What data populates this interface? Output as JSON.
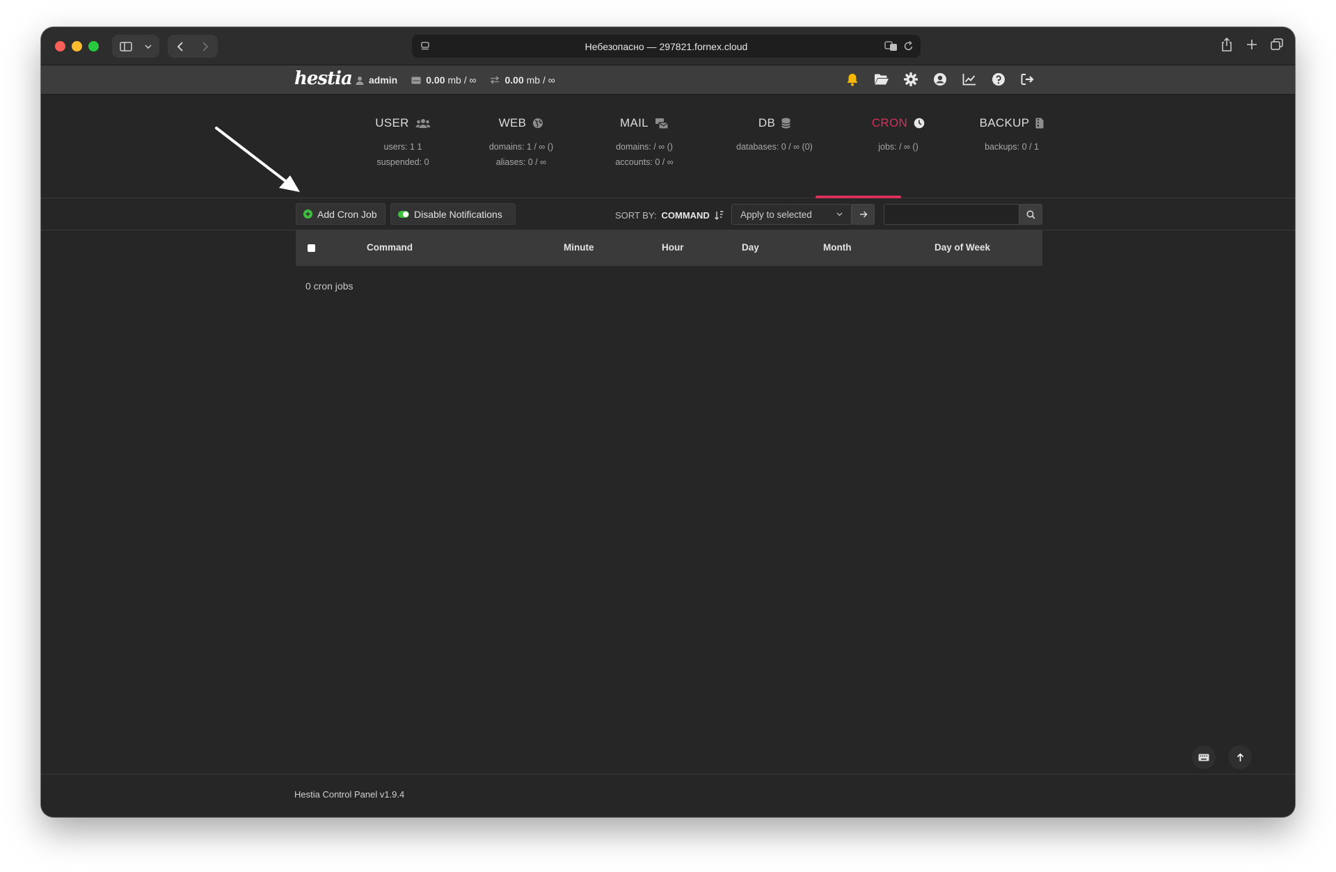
{
  "browser": {
    "url_text": "Небезопасно — 297821.fornex.cloud"
  },
  "topbar": {
    "logo": "hestia",
    "user": "admin",
    "disk_usage": "0.00",
    "disk_unit": "mb / ∞",
    "bandwidth_usage": "0.00",
    "bandwidth_unit": "mb / ∞"
  },
  "menu": {
    "tabs": [
      {
        "key": "user",
        "label": "USER",
        "stats": [
          "users: 1 1",
          "suspended: 0"
        ]
      },
      {
        "key": "web",
        "label": "WEB",
        "stats": [
          "domains: 1 / ∞ ()",
          "aliases: 0 / ∞"
        ]
      },
      {
        "key": "mail",
        "label": "MAIL",
        "stats": [
          "domains: / ∞ ()",
          "accounts: 0 / ∞"
        ]
      },
      {
        "key": "db",
        "label": "DB",
        "stats": [
          "databases: 0 / ∞ (0)"
        ]
      },
      {
        "key": "cron",
        "label": "CRON",
        "stats": [
          "jobs: / ∞ ()"
        ],
        "active": true
      },
      {
        "key": "backup",
        "label": "BACKUP",
        "stats": [
          "backups: 0 / 1"
        ]
      }
    ]
  },
  "toolbar": {
    "add_label": "Add Cron Job",
    "notify_label": "Disable Notifications",
    "sort_label": "SORT BY:",
    "sort_value": "COMMAND",
    "bulk_select_value": "Apply to selected",
    "search_placeholder": ""
  },
  "table": {
    "columns": [
      "Command",
      "Minute",
      "Hour",
      "Day",
      "Month",
      "Day of Week"
    ],
    "empty_text": "0 cron jobs"
  },
  "footer": {
    "text": "Hestia Control Panel v1.9.4"
  },
  "colors": {
    "accent": "#d8305a",
    "ok": "#3fbf3f",
    "notify_bell": "#f5b700"
  }
}
